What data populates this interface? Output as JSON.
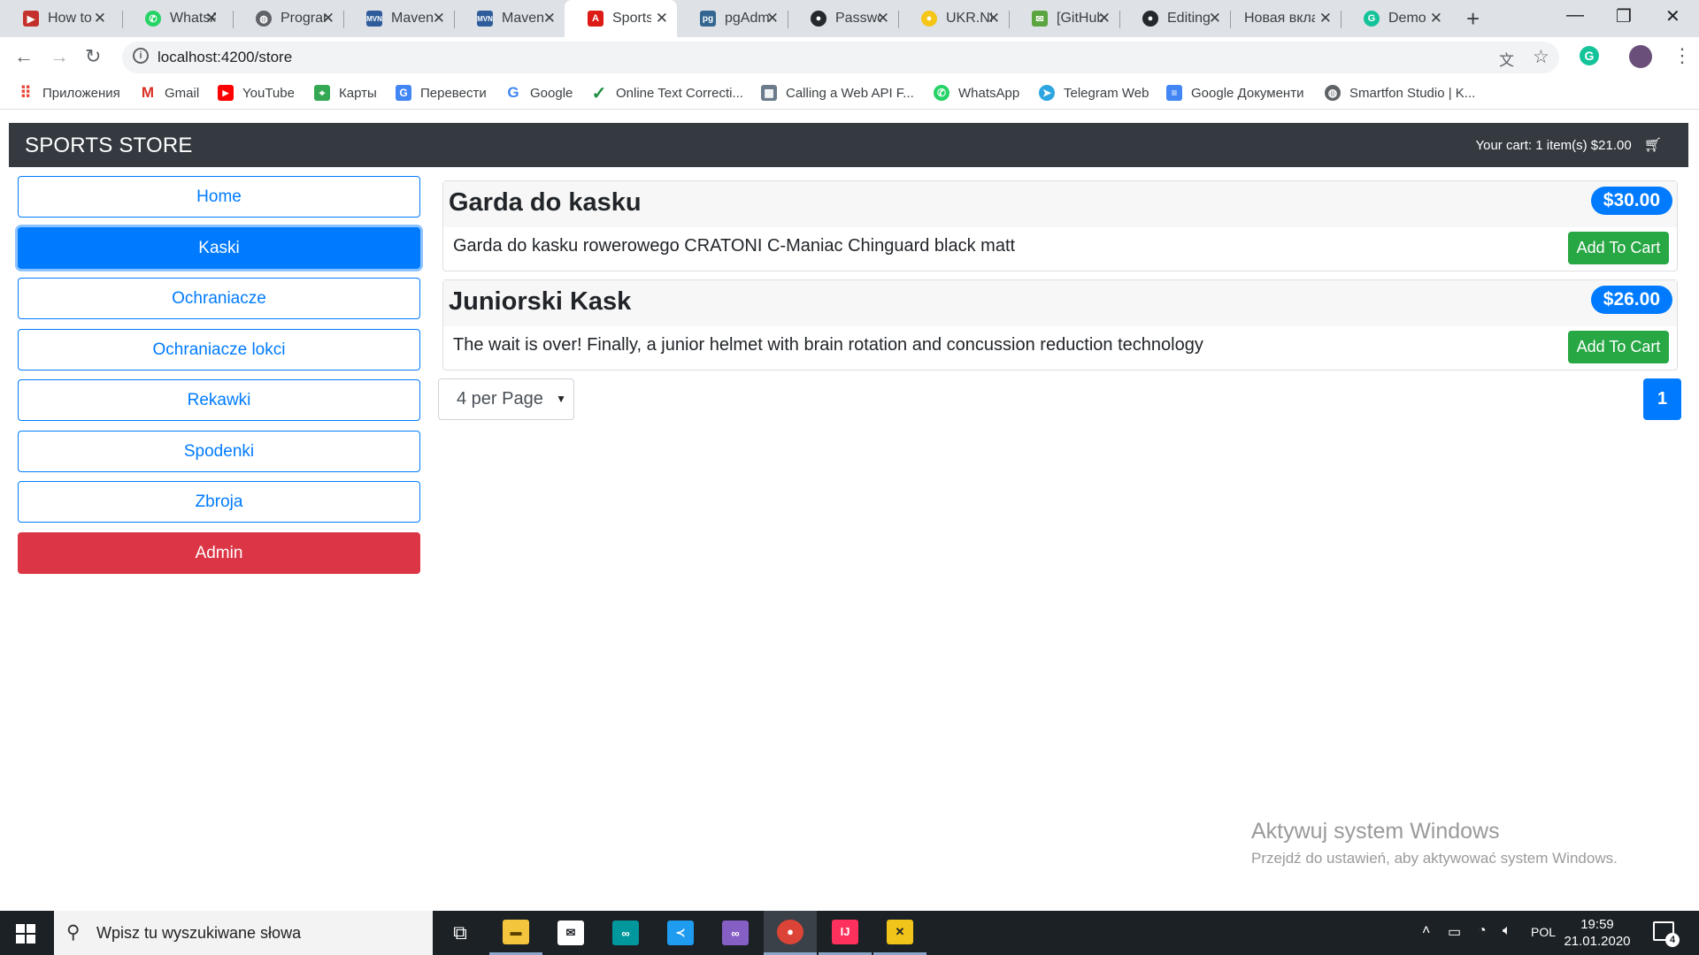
{
  "browser": {
    "tabs": [
      {
        "title": "How to",
        "icon": "youtube-icon",
        "color": "#c4302b"
      },
      {
        "title": "WhatsApp",
        "icon": "whatsapp-icon",
        "color": "#25d366"
      },
      {
        "title": "Program",
        "icon": "globe-icon",
        "color": "#5f6368"
      },
      {
        "title": "Maven",
        "icon": "maven-icon",
        "color": "#2e5c9a"
      },
      {
        "title": "Maven",
        "icon": "maven-icon",
        "color": "#2e5c9a"
      },
      {
        "title": "Sports",
        "icon": "angular-icon",
        "color": "#dd1b16",
        "active": true
      },
      {
        "title": "pgAdmin",
        "icon": "pgadmin-icon",
        "color": "#336791"
      },
      {
        "title": "Password",
        "icon": "github-icon",
        "color": "#24292e"
      },
      {
        "title": "UKR.NET",
        "icon": "ukrnet-icon",
        "color": "#f5c518"
      },
      {
        "title": "[GitHub]",
        "icon": "mail-icon",
        "color": "#5aa53f"
      },
      {
        "title": "Editing",
        "icon": "github-icon",
        "color": "#24292e"
      },
      {
        "title": "Новая вкладка",
        "icon": "",
        "color": ""
      },
      {
        "title": "Demo",
        "icon": "grammarly-icon",
        "color": "#15c39a"
      }
    ],
    "url": "localhost:4200/store",
    "bookmarks": [
      {
        "label": "Приложения",
        "icon": "apps-grid-icon",
        "color": "#ea4335"
      },
      {
        "label": "Gmail",
        "icon": "gmail-icon",
        "color": "#d93025"
      },
      {
        "label": "YouTube",
        "icon": "youtube-icon",
        "color": "#ff0000"
      },
      {
        "label": "Карты",
        "icon": "maps-icon",
        "color": "#34a853"
      },
      {
        "label": "Перевести",
        "icon": "translate-icon",
        "color": "#4285f4"
      },
      {
        "label": "Google",
        "icon": "google-icon",
        "color": "#4285f4"
      },
      {
        "label": "Online Text Correcti...",
        "icon": "checkmark-icon",
        "color": "#1e8e3e"
      },
      {
        "label": "Calling a Web API F...",
        "icon": "webapi-icon",
        "color": "#6b7b8c"
      },
      {
        "label": "WhatsApp",
        "icon": "whatsapp-icon",
        "color": "#25d366"
      },
      {
        "label": "Telegram Web",
        "icon": "telegram-icon",
        "color": "#2ca5e0"
      },
      {
        "label": "Google Документи",
        "icon": "docs-icon",
        "color": "#4285f4"
      },
      {
        "label": "Smartfon Studio | K...",
        "icon": "globe-icon",
        "color": "#5f6368"
      }
    ]
  },
  "store": {
    "brand": "SPORTS STORE",
    "cart_summary": "Your cart: 1 item(s) $21.00",
    "categories": [
      {
        "label": "Home",
        "active": false
      },
      {
        "label": "Kaski",
        "active": true
      },
      {
        "label": "Ochraniacze",
        "active": false
      },
      {
        "label": "Ochraniacze lokci",
        "active": false
      },
      {
        "label": "Rekawki",
        "active": false
      },
      {
        "label": "Spodenki",
        "active": false
      },
      {
        "label": "Zbroja",
        "active": false
      }
    ],
    "admin_label": "Admin",
    "products": [
      {
        "name": "Garda do kasku",
        "price": "$30.00",
        "description": "Garda do kasku rowerowego CRATONI C-Maniac Chinguard black matt",
        "button": "Add To Cart"
      },
      {
        "name": "Juniorski Kask",
        "price": "$26.00",
        "description": "The wait is over! Finally, a junior helmet with brain rotation and concussion reduction technology",
        "button": "Add To Cart"
      }
    ],
    "per_page": "4 per Page",
    "current_page": "1",
    "colors": {
      "primary": "#007bff",
      "success": "#28a745",
      "danger": "#dc3545",
      "navbar": "#343a40"
    }
  },
  "watermark": {
    "line1": "Aktywuj system Windows",
    "line2": "Przejdź do ustawień, aby aktywować system Windows."
  },
  "taskbar": {
    "search_placeholder": "Wpisz tu wyszukiwane słowa",
    "apps": [
      {
        "name": "task-view-icon",
        "color": ""
      },
      {
        "name": "file-explorer-icon",
        "color": "#f2c53d"
      },
      {
        "name": "mail-icon",
        "color": "#ffffff"
      },
      {
        "name": "arduino-icon",
        "color": "#00979d"
      },
      {
        "name": "vscode-icon",
        "color": "#1f9cf0"
      },
      {
        "name": "visual-studio-icon",
        "color": "#865fc5"
      },
      {
        "name": "chrome-icon",
        "color": "#db4437"
      },
      {
        "name": "intellij-icon",
        "color": "#fe315d"
      },
      {
        "name": "app-icon",
        "color": "#f0c419"
      }
    ],
    "language": "POL",
    "time": "19:59",
    "date": "21.01.2020",
    "notifications": "4"
  }
}
